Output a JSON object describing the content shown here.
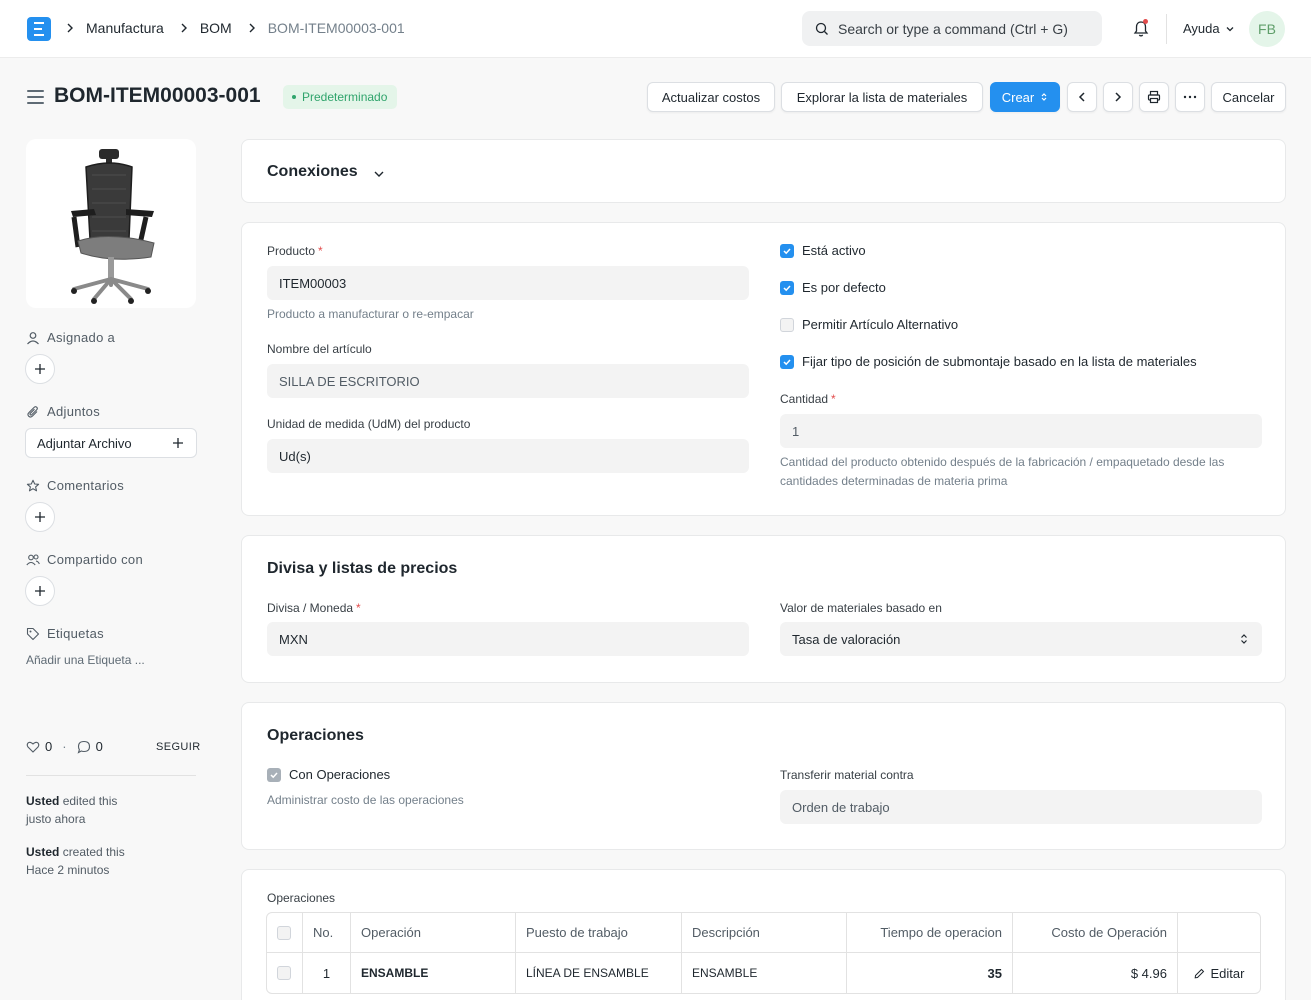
{
  "breadcrumbs": [
    "Manufactura",
    "BOM",
    "BOM-ITEM00003-001"
  ],
  "search": {
    "placeholder": "Search or type a command (Ctrl + G)"
  },
  "nav": {
    "help": "Ayuda",
    "avatar": "FB"
  },
  "page": {
    "title": "BOM-ITEM00003-001",
    "status": "Predeterminado"
  },
  "toolbar": {
    "update_costs": "Actualizar costos",
    "explore_bom": "Explorar la lista de materiales",
    "create": "Crear",
    "cancel": "Cancelar"
  },
  "sidebar": {
    "assigned_to": "Asignado a",
    "attachments": "Adjuntos",
    "attach_file": "Adjuntar Archivo",
    "comments": "Comentarios",
    "shared_with": "Compartido con",
    "tags": "Etiquetas",
    "add_tag": "Añadir una Etiqueta ...",
    "likes": "0",
    "comment_count": "0",
    "follow": "SEGUIR",
    "activity": [
      {
        "user": "Usted",
        "action": "edited this",
        "time": "justo ahora"
      },
      {
        "user": "Usted",
        "action": "created this",
        "time": "Hace 2 minutos"
      }
    ]
  },
  "connections": {
    "title": "Conexiones"
  },
  "details": {
    "product_label": "Producto",
    "product_value": "ITEM00003",
    "product_help": "Producto a manufacturar o re-empacar",
    "item_name_label": "Nombre del artículo",
    "item_name_value": "SILLA DE ESCRITORIO",
    "uom_label": "Unidad de medida (UdM) del producto",
    "uom_value": "Ud(s)",
    "is_active": "Está activo",
    "is_default": "Es por defecto",
    "allow_alt": "Permitir Artículo Alternativo",
    "set_subassembly": "Fijar tipo de posición de submontaje basado en la lista de materiales",
    "qty_label": "Cantidad",
    "qty_value": "1",
    "qty_help_1": "Cantidad del producto obtenido después de la fabricación / empaquetado desde las",
    "qty_help_2": "cantidades determinadas de materia prima"
  },
  "currency": {
    "title": "Divisa y listas de precios",
    "currency_label": "Divisa / Moneda",
    "currency_value": "MXN",
    "rate_label": "Valor de materiales basado en",
    "rate_value": "Tasa de valoración"
  },
  "operations": {
    "title": "Operaciones",
    "with_operations": "Con Operaciones",
    "with_operations_help": "Administrar costo de las operaciones",
    "transfer_label": "Transferir material contra",
    "transfer_value": "Orden de trabajo",
    "table_label": "Operaciones",
    "columns": [
      "No.",
      "Operación",
      "Puesto de trabajo",
      "Descripción",
      "Tiempo de operacion",
      "Costo de Operación"
    ],
    "rows": [
      {
        "no": "1",
        "operation": "ENSAMBLE",
        "workstation": "LÍNEA DE ENSAMBLE",
        "description": "ENSAMBLE",
        "time": "35",
        "cost": "$ 4.96",
        "edit": "Editar"
      }
    ]
  },
  "colors": {
    "primary": "#2490ef",
    "success": "#30a46c",
    "required": "#e24c4c"
  }
}
